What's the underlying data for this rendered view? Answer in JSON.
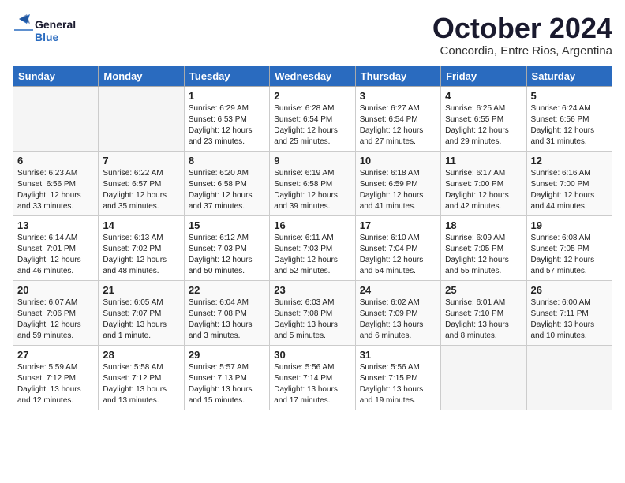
{
  "logo": {
    "line1": "General",
    "line2": "Blue"
  },
  "title": "October 2024",
  "subtitle": "Concordia, Entre Rios, Argentina",
  "header_days": [
    "Sunday",
    "Monday",
    "Tuesday",
    "Wednesday",
    "Thursday",
    "Friday",
    "Saturday"
  ],
  "weeks": [
    [
      {
        "day": "",
        "content": ""
      },
      {
        "day": "",
        "content": ""
      },
      {
        "day": "1",
        "content": "Sunrise: 6:29 AM\nSunset: 6:53 PM\nDaylight: 12 hours\nand 23 minutes."
      },
      {
        "day": "2",
        "content": "Sunrise: 6:28 AM\nSunset: 6:54 PM\nDaylight: 12 hours\nand 25 minutes."
      },
      {
        "day": "3",
        "content": "Sunrise: 6:27 AM\nSunset: 6:54 PM\nDaylight: 12 hours\nand 27 minutes."
      },
      {
        "day": "4",
        "content": "Sunrise: 6:25 AM\nSunset: 6:55 PM\nDaylight: 12 hours\nand 29 minutes."
      },
      {
        "day": "5",
        "content": "Sunrise: 6:24 AM\nSunset: 6:56 PM\nDaylight: 12 hours\nand 31 minutes."
      }
    ],
    [
      {
        "day": "6",
        "content": "Sunrise: 6:23 AM\nSunset: 6:56 PM\nDaylight: 12 hours\nand 33 minutes."
      },
      {
        "day": "7",
        "content": "Sunrise: 6:22 AM\nSunset: 6:57 PM\nDaylight: 12 hours\nand 35 minutes."
      },
      {
        "day": "8",
        "content": "Sunrise: 6:20 AM\nSunset: 6:58 PM\nDaylight: 12 hours\nand 37 minutes."
      },
      {
        "day": "9",
        "content": "Sunrise: 6:19 AM\nSunset: 6:58 PM\nDaylight: 12 hours\nand 39 minutes."
      },
      {
        "day": "10",
        "content": "Sunrise: 6:18 AM\nSunset: 6:59 PM\nDaylight: 12 hours\nand 41 minutes."
      },
      {
        "day": "11",
        "content": "Sunrise: 6:17 AM\nSunset: 7:00 PM\nDaylight: 12 hours\nand 42 minutes."
      },
      {
        "day": "12",
        "content": "Sunrise: 6:16 AM\nSunset: 7:00 PM\nDaylight: 12 hours\nand 44 minutes."
      }
    ],
    [
      {
        "day": "13",
        "content": "Sunrise: 6:14 AM\nSunset: 7:01 PM\nDaylight: 12 hours\nand 46 minutes."
      },
      {
        "day": "14",
        "content": "Sunrise: 6:13 AM\nSunset: 7:02 PM\nDaylight: 12 hours\nand 48 minutes."
      },
      {
        "day": "15",
        "content": "Sunrise: 6:12 AM\nSunset: 7:03 PM\nDaylight: 12 hours\nand 50 minutes."
      },
      {
        "day": "16",
        "content": "Sunrise: 6:11 AM\nSunset: 7:03 PM\nDaylight: 12 hours\nand 52 minutes."
      },
      {
        "day": "17",
        "content": "Sunrise: 6:10 AM\nSunset: 7:04 PM\nDaylight: 12 hours\nand 54 minutes."
      },
      {
        "day": "18",
        "content": "Sunrise: 6:09 AM\nSunset: 7:05 PM\nDaylight: 12 hours\nand 55 minutes."
      },
      {
        "day": "19",
        "content": "Sunrise: 6:08 AM\nSunset: 7:05 PM\nDaylight: 12 hours\nand 57 minutes."
      }
    ],
    [
      {
        "day": "20",
        "content": "Sunrise: 6:07 AM\nSunset: 7:06 PM\nDaylight: 12 hours\nand 59 minutes."
      },
      {
        "day": "21",
        "content": "Sunrise: 6:05 AM\nSunset: 7:07 PM\nDaylight: 13 hours\nand 1 minute."
      },
      {
        "day": "22",
        "content": "Sunrise: 6:04 AM\nSunset: 7:08 PM\nDaylight: 13 hours\nand 3 minutes."
      },
      {
        "day": "23",
        "content": "Sunrise: 6:03 AM\nSunset: 7:08 PM\nDaylight: 13 hours\nand 5 minutes."
      },
      {
        "day": "24",
        "content": "Sunrise: 6:02 AM\nSunset: 7:09 PM\nDaylight: 13 hours\nand 6 minutes."
      },
      {
        "day": "25",
        "content": "Sunrise: 6:01 AM\nSunset: 7:10 PM\nDaylight: 13 hours\nand 8 minutes."
      },
      {
        "day": "26",
        "content": "Sunrise: 6:00 AM\nSunset: 7:11 PM\nDaylight: 13 hours\nand 10 minutes."
      }
    ],
    [
      {
        "day": "27",
        "content": "Sunrise: 5:59 AM\nSunset: 7:12 PM\nDaylight: 13 hours\nand 12 minutes."
      },
      {
        "day": "28",
        "content": "Sunrise: 5:58 AM\nSunset: 7:12 PM\nDaylight: 13 hours\nand 13 minutes."
      },
      {
        "day": "29",
        "content": "Sunrise: 5:57 AM\nSunset: 7:13 PM\nDaylight: 13 hours\nand 15 minutes."
      },
      {
        "day": "30",
        "content": "Sunrise: 5:56 AM\nSunset: 7:14 PM\nDaylight: 13 hours\nand 17 minutes."
      },
      {
        "day": "31",
        "content": "Sunrise: 5:56 AM\nSunset: 7:15 PM\nDaylight: 13 hours\nand 19 minutes."
      },
      {
        "day": "",
        "content": ""
      },
      {
        "day": "",
        "content": ""
      }
    ]
  ]
}
